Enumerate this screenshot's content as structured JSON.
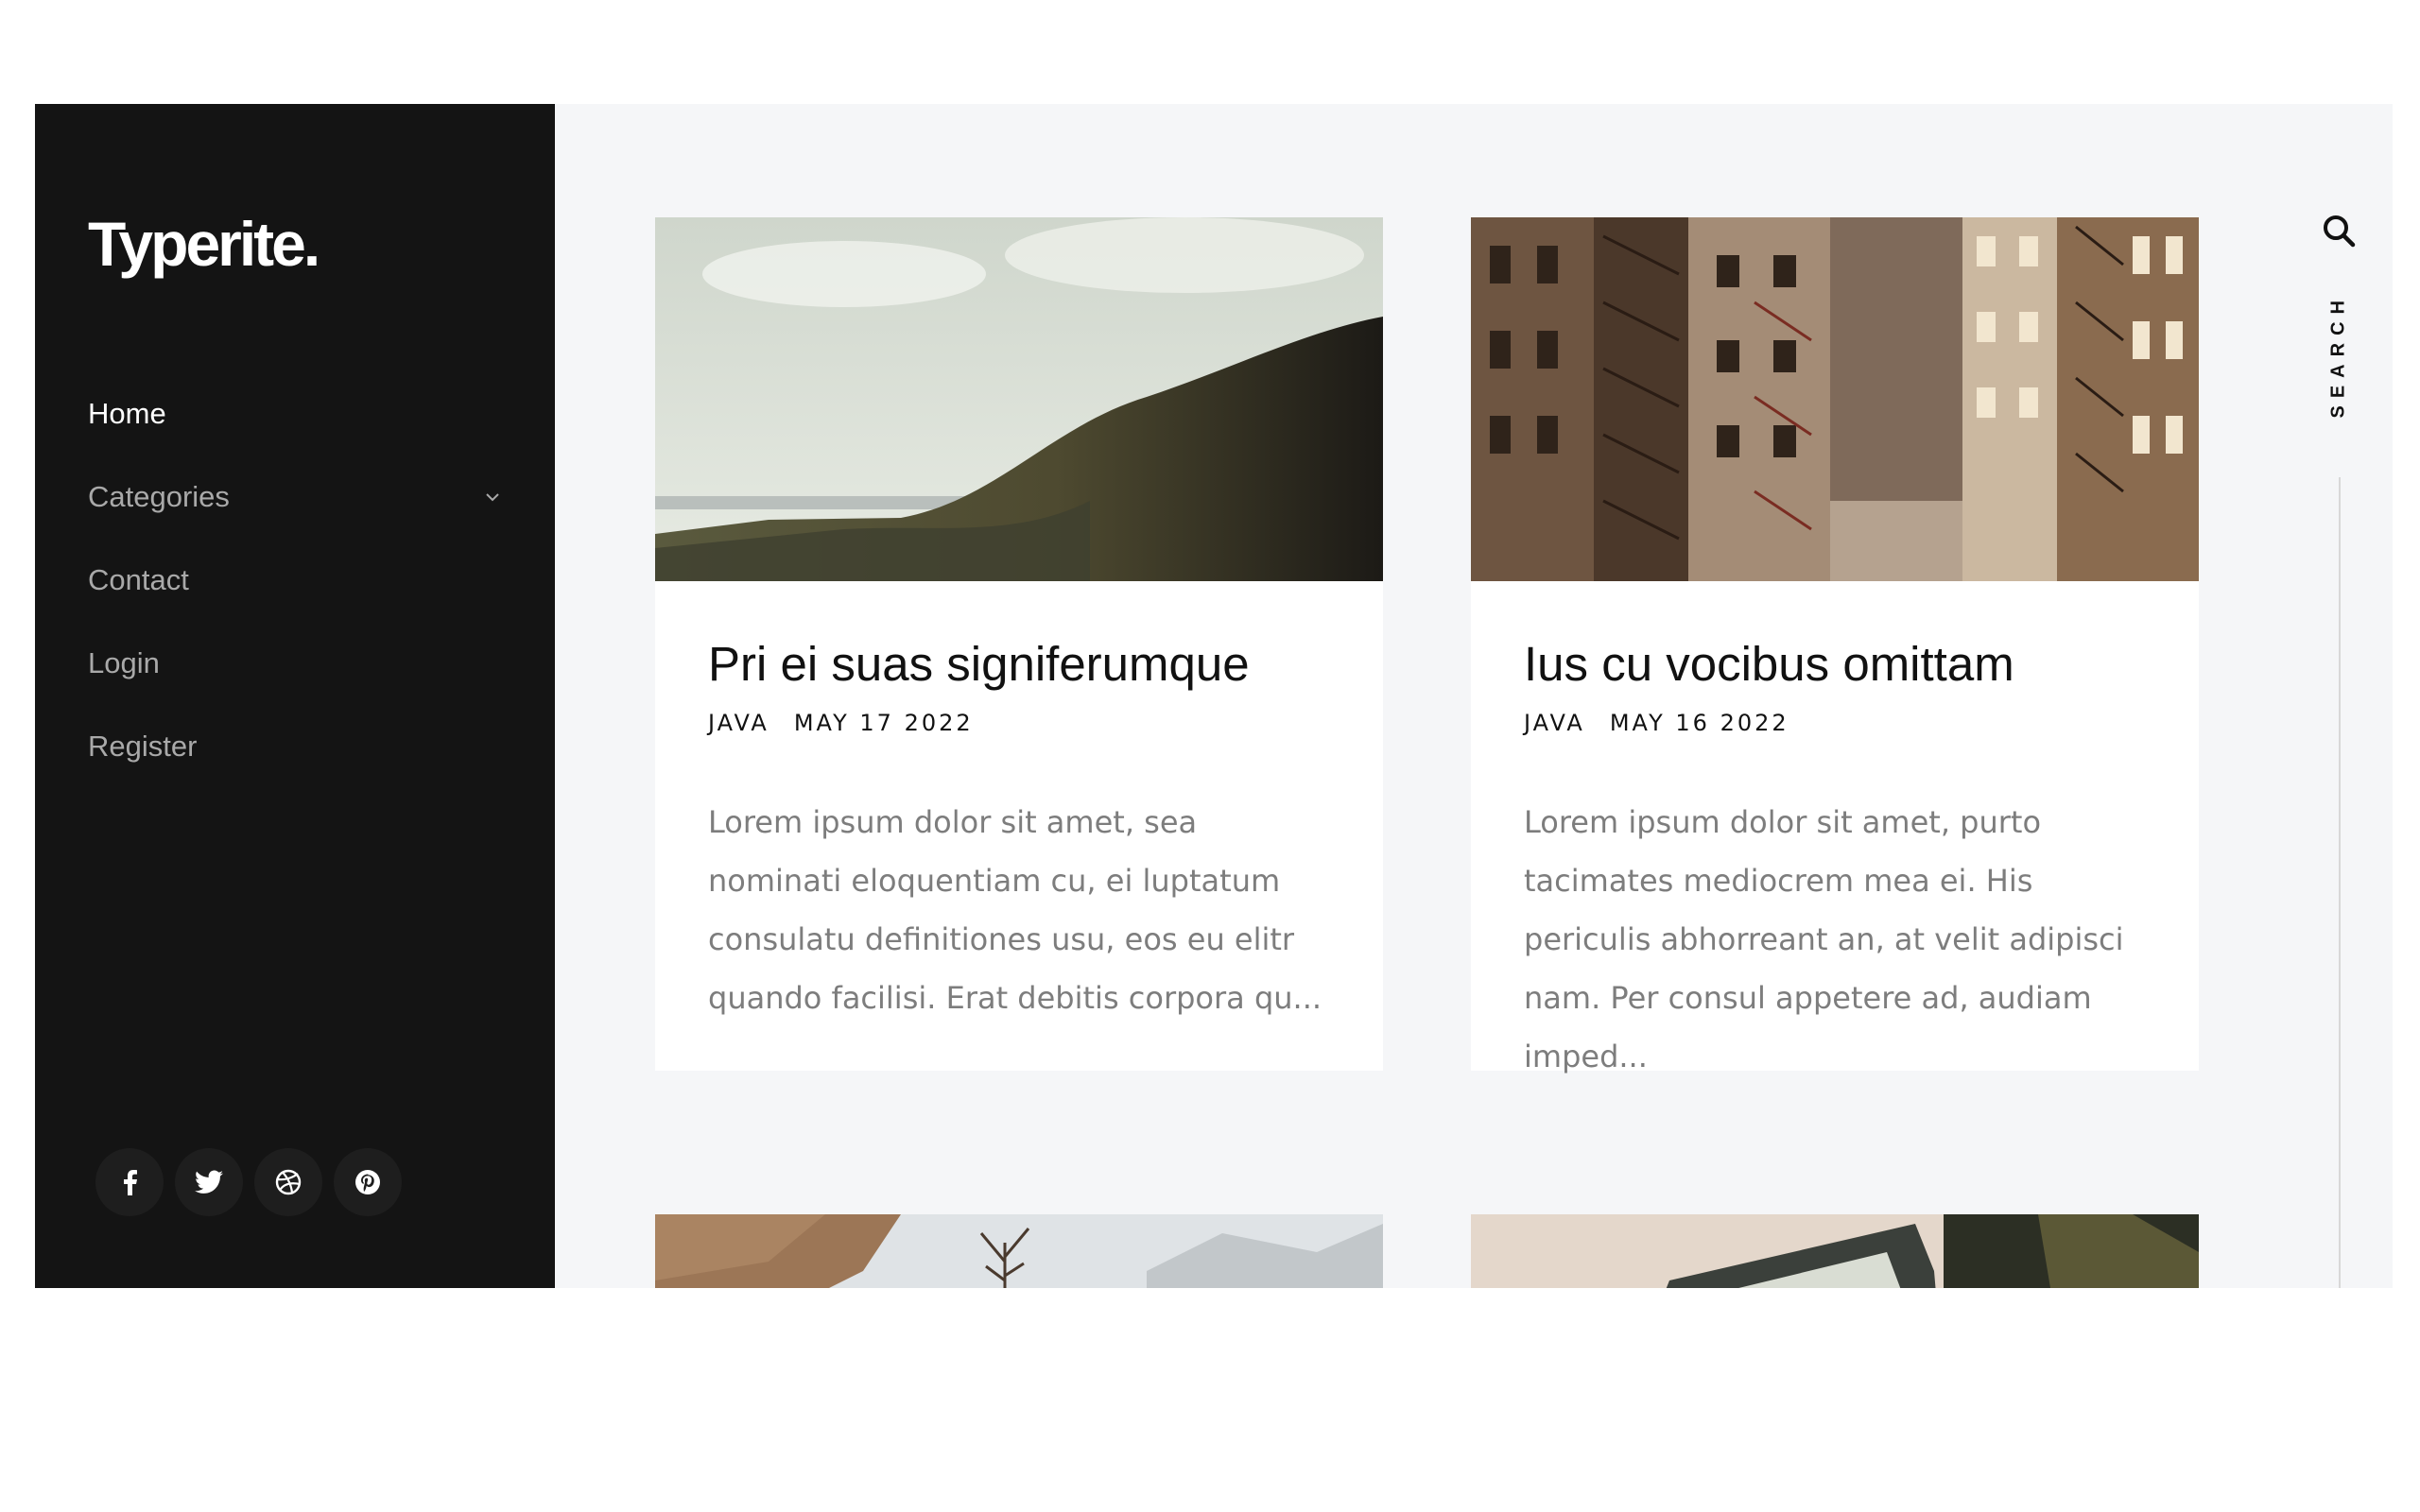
{
  "brand": {
    "logo": "Typerite."
  },
  "nav": {
    "items": [
      {
        "label": "Home"
      },
      {
        "label": "Categories"
      },
      {
        "label": "Contact"
      },
      {
        "label": "Login"
      },
      {
        "label": "Register"
      }
    ]
  },
  "social": {
    "icons": [
      "facebook-icon",
      "twitter-icon",
      "dribbble-icon",
      "pinterest-icon"
    ]
  },
  "search": {
    "label": "SEARCH"
  },
  "posts": [
    {
      "title": "Pri ei suas signiferumque",
      "category": "JAVA",
      "date": "MAY 17 2022",
      "excerpt": "Lorem ipsum dolor sit amet, sea nominati eloquentiam cu, ei luptatum consulatu definitiones usu, eos eu elitr quando facilisi. Erat debitis corpora qu..."
    },
    {
      "title": "Ius cu vocibus omittam",
      "category": "JAVA",
      "date": "MAY 16 2022",
      "excerpt": "Lorem ipsum dolor sit amet, purto tacimates mediocrem mea ei. His periculis abhorreant an, at velit adipisci nam. Per consul appetere ad, audiam imped..."
    }
  ],
  "colors": {
    "sidebar_bg": "#141414",
    "content_bg": "#f5f6f8",
    "card_bg": "#ffffff",
    "nav_active": "#ffffff",
    "nav_inactive": "#a9a9a9",
    "excerpt_text": "#7d7d7d"
  }
}
